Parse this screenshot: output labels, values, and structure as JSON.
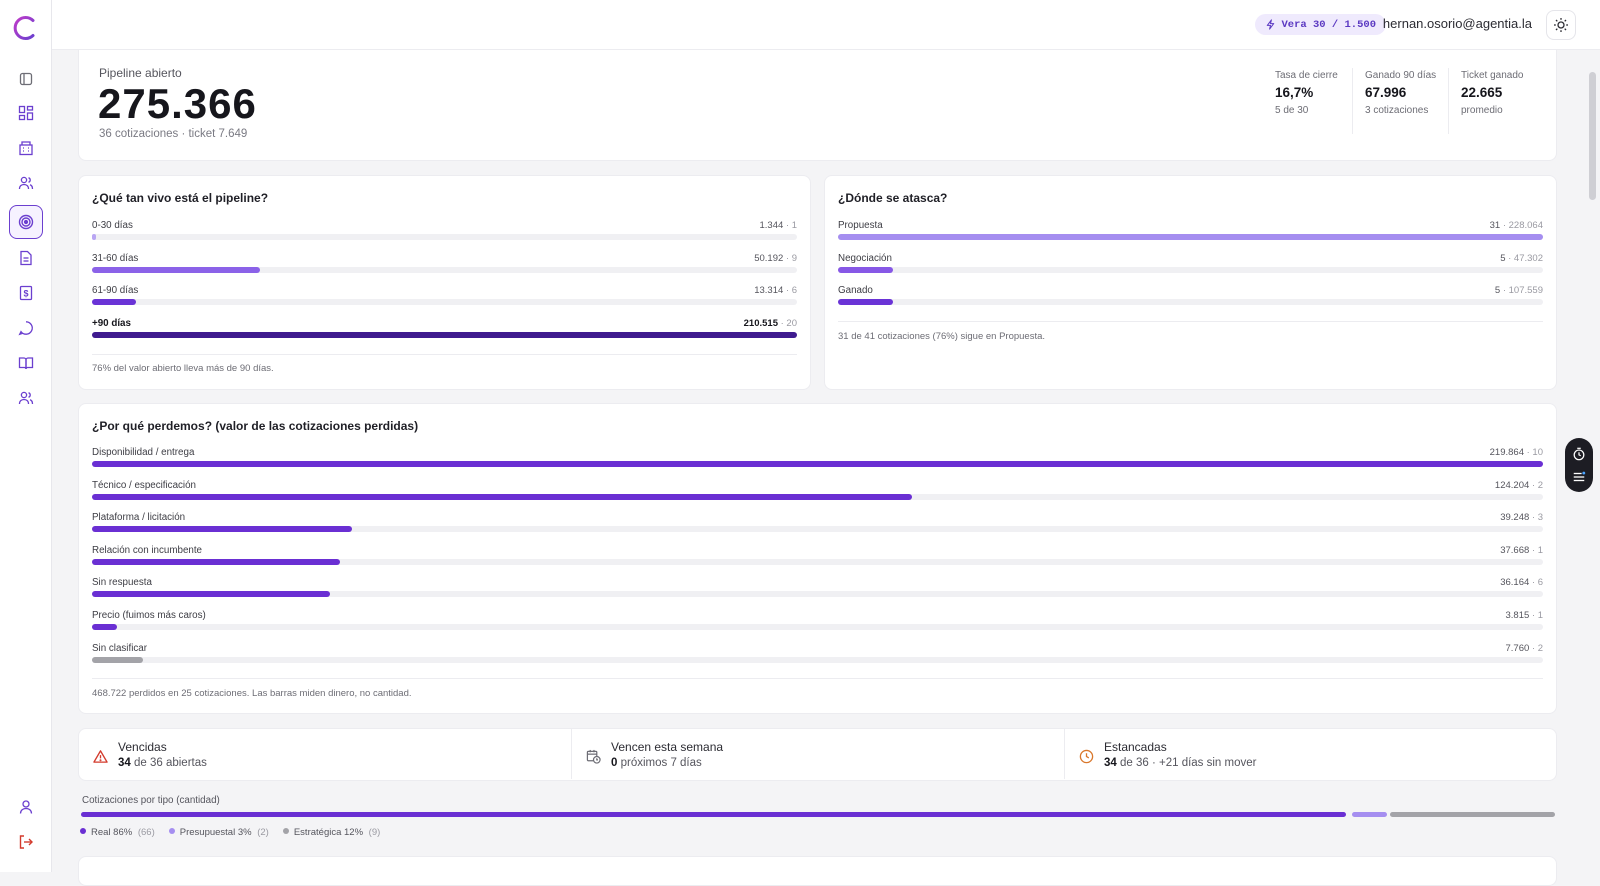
{
  "topbar": {
    "credits": "Vera 30 / 1.500",
    "email": "hernan.osorio@agentia.la"
  },
  "sidebar": {
    "items": [
      "panel-toggle-icon",
      "dashboard-icon",
      "building-icon",
      "users-icon",
      "target-icon",
      "document-icon",
      "invoice-icon",
      "chat-icon",
      "book-icon",
      "team-icon"
    ],
    "bottom": [
      "profile-icon",
      "logout-icon"
    ],
    "active": "target-icon"
  },
  "pipeline": {
    "label": "Pipeline abierto",
    "value": "275.366",
    "sub": "36 cotizaciones · ticket 7.649",
    "stats": [
      {
        "label": "Tasa de cierre",
        "value": "16,7%",
        "sub": "5 de 30"
      },
      {
        "label": "Ganado 90 días",
        "value": "67.996",
        "sub": "3 cotizaciones"
      },
      {
        "label": "Ticket ganado",
        "value": "22.665",
        "sub": "promedio"
      }
    ]
  },
  "alive": {
    "title": "¿Qué tan vivo está el pipeline?",
    "rows": [
      {
        "label": "0-30 días",
        "value": "1.344",
        "count": "· 1",
        "fraction": 0.006,
        "color": "#b9a6f3"
      },
      {
        "label": "31-60 días",
        "value": "50.192",
        "count": "· 9",
        "fraction": 0.239,
        "color": "#8b62e8"
      },
      {
        "label": "61-90 días",
        "value": "13.314",
        "count": "· 6",
        "fraction": 0.063,
        "color": "#6a33d6"
      },
      {
        "label": "+90 días",
        "value": "210.515",
        "count": "· 20",
        "fraction": 1.0,
        "color": "#3f1b8f",
        "bold": true
      }
    ],
    "note": "76% del valor abierto lleva más de 90 días."
  },
  "stuck": {
    "title": "¿Dónde se atasca?",
    "rows": [
      {
        "label": "Propuesta",
        "value": "31",
        "count": "· 228.064",
        "fraction": 1.0,
        "color": "#a58ef0"
      },
      {
        "label": "Negociación",
        "value": "5",
        "count": "· 47.302",
        "fraction": 0.078,
        "color": "#8758e6"
      },
      {
        "label": "Ganado",
        "value": "5",
        "count": "· 107.559",
        "fraction": 0.078,
        "color": "#6a33d6"
      }
    ],
    "note": "31 de 41 cotizaciones (76%) sigue en Propuesta."
  },
  "lost": {
    "title": "¿Por qué perdemos? (valor de las cotizaciones perdidas)",
    "rows": [
      {
        "label": "Disponibilidad / entrega",
        "value": "219.864",
        "count": "· 10",
        "fraction": 1.0,
        "color": "#6a2fd3"
      },
      {
        "label": "Técnico / especificación",
        "value": "124.204",
        "count": "· 2",
        "fraction": 0.565,
        "color": "#6a2fd3"
      },
      {
        "label": "Plataforma / licitación",
        "value": "39.248",
        "count": "· 3",
        "fraction": 0.179,
        "color": "#6a2fd3"
      },
      {
        "label": "Relación con incumbente",
        "value": "37.668",
        "count": "· 1",
        "fraction": 0.171,
        "color": "#6a2fd3"
      },
      {
        "label": "Sin respuesta",
        "value": "36.164",
        "count": "· 6",
        "fraction": 0.164,
        "color": "#6a2fd3"
      },
      {
        "label": "Precio (fuimos más caros)",
        "value": "3.815",
        "count": "· 1",
        "fraction": 0.017,
        "color": "#6a2fd3"
      },
      {
        "label": "Sin clasificar",
        "value": "7.760",
        "count": "· 2",
        "fraction": 0.035,
        "color": "#a3a3a8"
      }
    ],
    "note": "468.722 perdidos en 25 cotizaciones. Las barras miden dinero, no cantidad."
  },
  "alerts": [
    {
      "title": "Vencidas",
      "num": "34",
      "rest": " de 36 abiertas",
      "icon": "warning-icon",
      "color": "#d33a2c"
    },
    {
      "title": "Vencen esta semana",
      "num": "0",
      "rest": " próximos 7 días",
      "icon": "calendar-clock-icon",
      "color": "#6d6d75"
    },
    {
      "title": "Estancadas",
      "num": "34",
      "rest": " de 36 · +21 días sin mover",
      "icon": "clock-icon",
      "color": "#d9772b"
    }
  ],
  "types": {
    "label": "Cotizaciones por tipo (cantidad)",
    "segments": [
      {
        "name": "Real 86%",
        "count": "(66)",
        "fraction": 0.86,
        "color": "#6a2fd3"
      },
      {
        "name": "Presupuestal 3%",
        "count": "(2)",
        "fraction": 0.026,
        "color": "#a58ef0"
      },
      {
        "name": "Estratégica 12%",
        "count": "(9)",
        "fraction": 0.114,
        "color": "#a3a3a8"
      }
    ]
  }
}
